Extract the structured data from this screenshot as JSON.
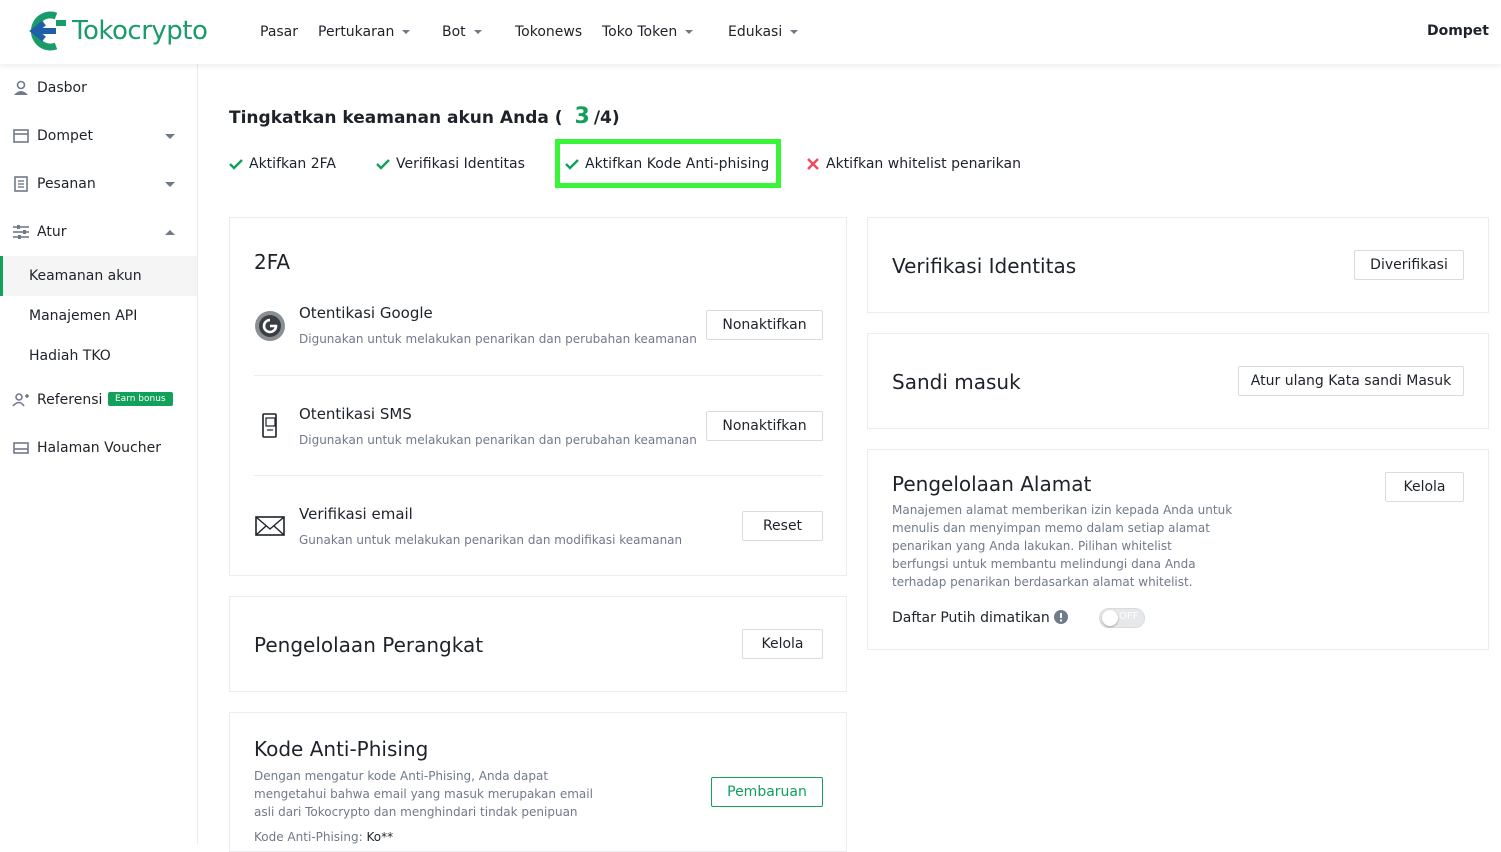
{
  "header": {
    "logo_text": "Tokocrypto",
    "nav": [
      {
        "label": "Pasar",
        "dropdown": false
      },
      {
        "label": "Pertukaran",
        "dropdown": true
      },
      {
        "label": "Bot",
        "dropdown": true
      },
      {
        "label": "Tokonews",
        "dropdown": false
      },
      {
        "label": "Toko Token",
        "dropdown": true
      },
      {
        "label": "Edukasi",
        "dropdown": true
      }
    ],
    "wallet": "Dompet"
  },
  "sidebar": {
    "items": [
      {
        "label": "Dasbor"
      },
      {
        "label": "Dompet"
      },
      {
        "label": "Pesanan"
      },
      {
        "label": "Atur"
      },
      {
        "label": "Keamanan akun"
      },
      {
        "label": "Manajemen API"
      },
      {
        "label": "Hadiah TKO"
      },
      {
        "label": "Referensi"
      },
      {
        "label": "Halaman Voucher"
      }
    ],
    "earn_badge": "Earn bonus"
  },
  "security": {
    "title_prefix": "Tingkatkan keamanan akun Anda (",
    "count": "3",
    "title_suffix": "/4)",
    "steps": [
      {
        "label": "Aktifkan 2FA",
        "done": true
      },
      {
        "label": "Verifikasi Identitas",
        "done": true
      },
      {
        "label": "Aktifkan Kode Anti-phising",
        "done": true
      },
      {
        "label": "Aktifkan whitelist penarikan",
        "done": false
      }
    ]
  },
  "twofa": {
    "title": "2FA",
    "rows": [
      {
        "title": "Otentikasi Google",
        "desc": "Digunakan untuk melakukan penarikan dan perubahan keamanan",
        "button": "Nonaktifkan"
      },
      {
        "title": "Otentikasi SMS",
        "desc": "Digunakan untuk melakukan penarikan dan perubahan keamanan",
        "button": "Nonaktifkan"
      },
      {
        "title": "Verifikasi email",
        "desc": "Gunakan untuk melakukan penarikan dan modifikasi keamanan",
        "button": "Reset"
      }
    ]
  },
  "device": {
    "title": "Pengelolaan Perangkat",
    "button": "Kelola"
  },
  "antiphishing": {
    "title": "Kode Anti-Phising",
    "desc_lines": [
      "Dengan mengatur kode Anti-Phising, Anda dapat",
      "mengetahui bahwa email yang masuk merupakan email",
      "asli dari Tokocrypto dan menghindari tindak penipuan"
    ],
    "code_label": "Kode Anti-Phising: ",
    "code_value": "Ko**",
    "button": "Pembaruan"
  },
  "identity": {
    "title": "Verifikasi Identitas",
    "button": "Diverifikasi"
  },
  "password": {
    "title": "Sandi masuk",
    "button": "Atur ulang Kata sandi Masuk"
  },
  "address": {
    "title": "Pengelolaan Alamat",
    "desc_lines": [
      "Manajemen alamat memberikan izin kepada Anda untuk",
      "menulis dan menyimpan memo dalam setiap alamat",
      "penarikan yang Anda lakukan. Pilihan whitelist",
      "berfungsi untuk membantu melindungi dana Anda",
      "terhadap penarikan berdasarkan alamat whitelist."
    ],
    "whitelist_label": "Daftar Putih dimatikan",
    "toggle_text": "OFF",
    "button": "Kelola"
  },
  "colors": {
    "brand": "#12a05b",
    "highlight": "#39f53a",
    "error": "#f6465d"
  }
}
